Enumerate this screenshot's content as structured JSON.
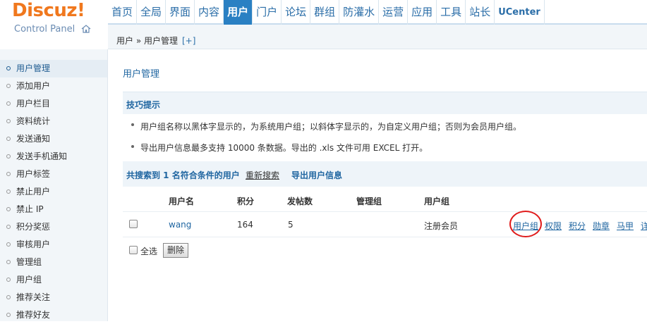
{
  "header": {
    "logo": "Discuz!",
    "logo_subtitle": "Control Panel",
    "nav": [
      "首页",
      "全局",
      "界面",
      "内容",
      "用户",
      "门户",
      "论坛",
      "群组",
      "防灌水",
      "运营",
      "应用",
      "工具",
      "站长",
      "UCenter"
    ],
    "active_nav": "用户",
    "breadcrumb": "用户 » 用户管理",
    "breadcrumb_add": "[+]"
  },
  "sidebar": {
    "items": [
      "用户管理",
      "添加用户",
      "用户栏目",
      "资料统计",
      "发送通知",
      "发送手机通知",
      "用户标签",
      "禁止用户",
      "禁止 IP",
      "积分奖惩",
      "审核用户",
      "管理组",
      "用户组",
      "推荐关注",
      "推荐好友"
    ],
    "active": "用户管理"
  },
  "main": {
    "title": "用户管理",
    "tips_title": "技巧提示",
    "tips": [
      "用户组名称以黑体字显示的，为系统用户组；以斜体字显示的，为自定义用户组；否则为会员用户组。",
      "导出用户信息最多支持 10000 条数据。导出的 .xls 文件可用 EXCEL 打开。"
    ],
    "result_count": "共搜索到 1 名符合条件的用户",
    "research_link": "重新搜索",
    "export_link": "导出用户信息",
    "columns": [
      "用户名",
      "积分",
      "发帖数",
      "管理组",
      "用户组"
    ],
    "row": {
      "username": "wang",
      "credits": "164",
      "posts": "5",
      "admin_group": "",
      "user_group": "注册会员",
      "actions": [
        "用户组",
        "权限",
        "积分",
        "勋章",
        "马甲",
        "详"
      ]
    },
    "select_all": "全选",
    "delete_button": "删除"
  },
  "colors": {
    "accent": "#2a80c3",
    "logo": "#f0781e",
    "highlight": "#e01b1b"
  }
}
